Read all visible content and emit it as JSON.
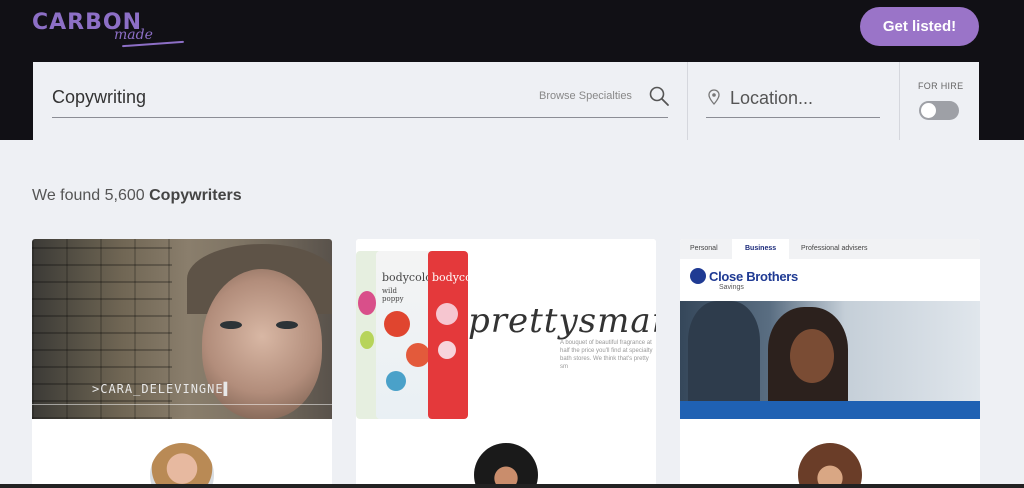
{
  "header": {
    "logo_text": "CARBON",
    "logo_sub": "made",
    "get_listed_label": "Get listed!"
  },
  "search": {
    "specialty_value": "Copywriting",
    "browse_label": "Browse Specialties",
    "location_placeholder": "Location...",
    "for_hire_label": "FOR HIRE",
    "for_hire_enabled": false
  },
  "results": {
    "prefix": "We found 5,600 ",
    "category": "Copywriters"
  },
  "cards": [
    {
      "thumb_caption": ">CARA_DELEVINGNE▌"
    },
    {
      "tube_brand_1": "bodycology",
      "tube_brand_2": "bodycology",
      "tube_flavor": "wild poppy",
      "headline": "prettysmar",
      "small_text": "A bouquet of beautiful fragrance at half the price you'll find at specialty bath stores. We think that's pretty sm"
    },
    {
      "tabs": [
        "Personal",
        "Business",
        "Professional advisers"
      ],
      "active_tab": "Business",
      "brand_name": "Close Brothers",
      "brand_sub": "Savings"
    }
  ],
  "colors": {
    "brand_purple": "#9a74c8",
    "topbar": "#111015",
    "page_bg": "#eef0f4"
  }
}
